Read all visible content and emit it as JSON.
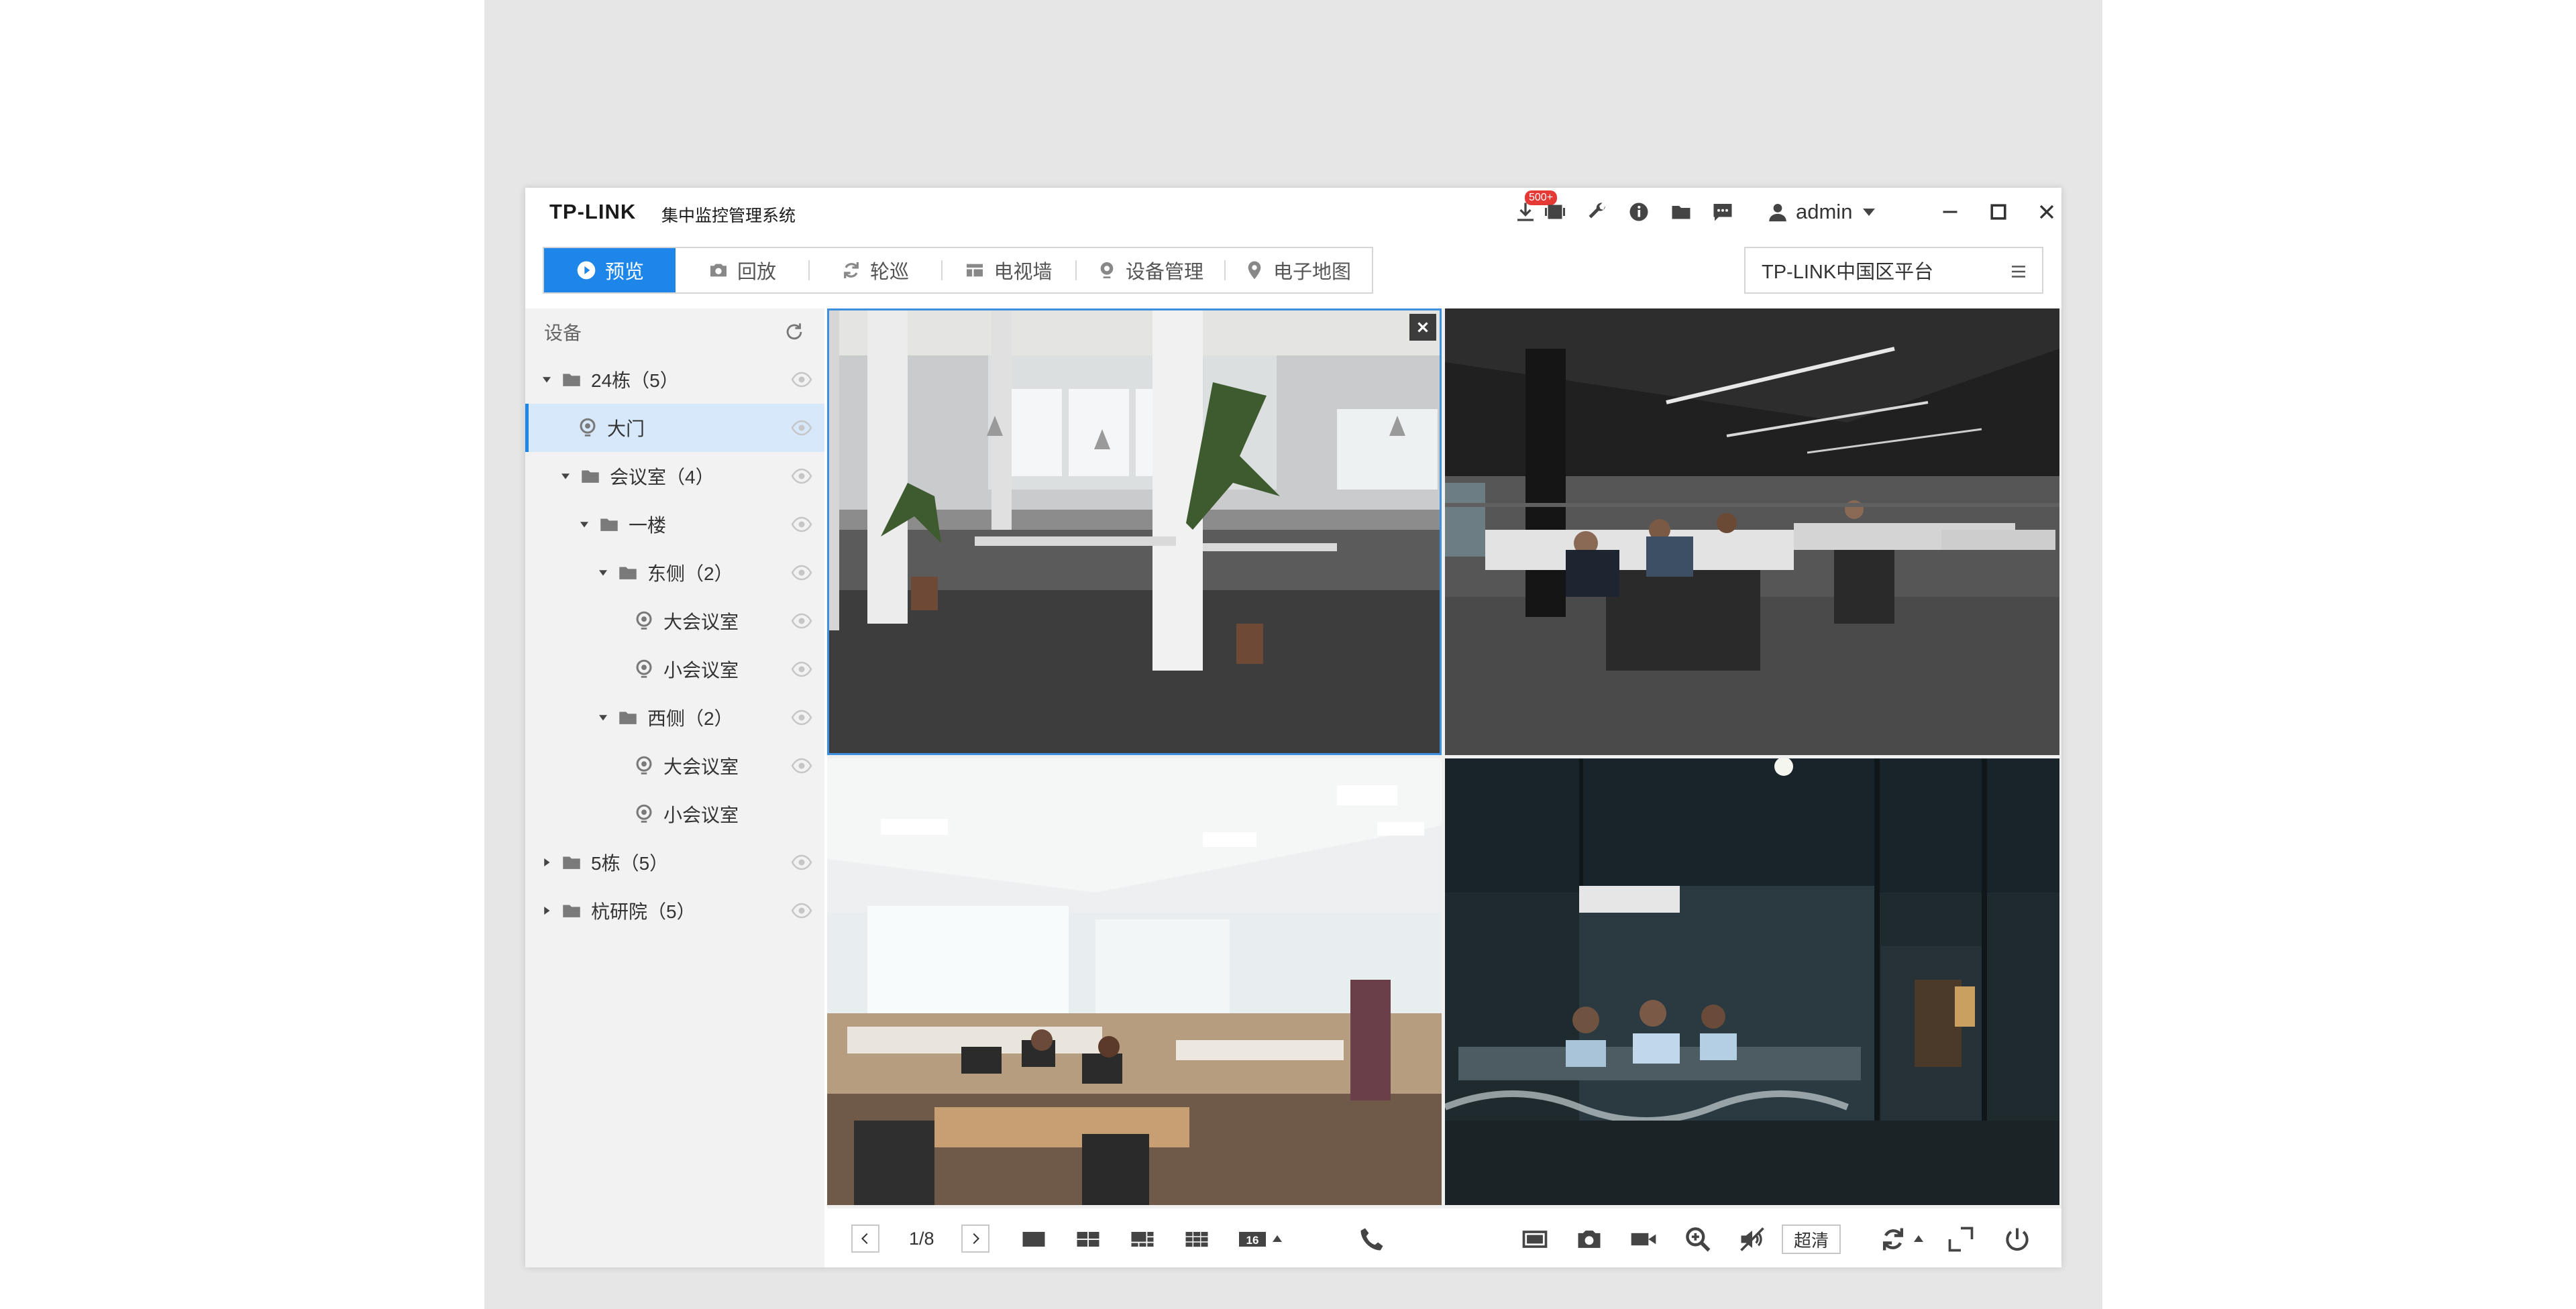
{
  "app": {
    "logo": "TP-LINK",
    "system_name": "集中监控管理系统",
    "download_badge": "500+",
    "user": "admin"
  },
  "nav": {
    "tabs": [
      {
        "label": "预览",
        "icon": "play-icon",
        "active": true
      },
      {
        "label": "回放",
        "icon": "camera-icon",
        "active": false
      },
      {
        "label": "轮巡",
        "icon": "cycle-icon",
        "active": false
      },
      {
        "label": "电视墙",
        "icon": "tv-wall-icon",
        "active": false
      },
      {
        "label": "设备管理",
        "icon": "location-pin-icon",
        "active": false
      },
      {
        "label": "电子地图",
        "icon": "map-pin-icon",
        "active": false
      }
    ],
    "platform": "TP-LINK中国区平台"
  },
  "sidebar": {
    "title": "设备",
    "tree": [
      {
        "label": "24栋（5）",
        "level": 0,
        "type": "folder",
        "expanded": true
      },
      {
        "label": "大门",
        "level": 1,
        "type": "camera",
        "selected": true
      },
      {
        "label": "会议室（4）",
        "level": 1,
        "type": "folder",
        "expanded": true
      },
      {
        "label": "一楼",
        "level": 2,
        "type": "folder",
        "expanded": true
      },
      {
        "label": "东侧（2）",
        "level": 3,
        "type": "folder",
        "expanded": true
      },
      {
        "label": "大会议室",
        "level": 4,
        "type": "camera"
      },
      {
        "label": "小会议室",
        "level": 4,
        "type": "camera"
      },
      {
        "label": "西侧（2）",
        "level": 3,
        "type": "folder",
        "expanded": true
      },
      {
        "label": "大会议室",
        "level": 4,
        "type": "camera"
      },
      {
        "label": "小会议室",
        "level": 4,
        "type": "camera"
      },
      {
        "label": "5栋（5）",
        "level": 0,
        "type": "folder",
        "expanded": false
      },
      {
        "label": "杭研院（5）",
        "level": 0,
        "type": "folder",
        "expanded": false
      }
    ]
  },
  "toolbar": {
    "page": "1/8",
    "split_count": "16",
    "quality": "超清"
  }
}
